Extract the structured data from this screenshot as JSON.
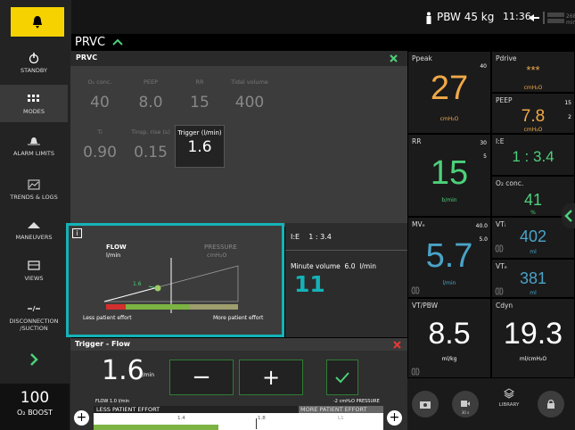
{
  "sidebar": {
    "standby": "STANDBY",
    "modes": "MODES",
    "alarm_limits": "ALARM LIMITS",
    "trends_logs": "TRENDS & LOGS",
    "maneuvers": "MANEUVERS",
    "views": "VIEWS",
    "disconnection": "DISCONNECTION /SUCTION",
    "o2_value": "100",
    "o2_label": "O₂ BOOST"
  },
  "topbar": {
    "pbw": "PBW 45 kg",
    "time": "11:36",
    "battery": "268 min"
  },
  "mode": {
    "title": "PRVC",
    "panel_title": "PRVC"
  },
  "params": [
    {
      "label": "O₂ conc.",
      "value": "40"
    },
    {
      "label": "PEEP",
      "value": "8.0"
    },
    {
      "label": "RR",
      "value": "15"
    },
    {
      "label": "Tidal volume",
      "value": "400"
    },
    {
      "label": "Ti",
      "value": "0.90"
    },
    {
      "label": "Tinsp. rise (s)",
      "value": "0.15"
    },
    {
      "label": "Trigger (l/min)",
      "value": "1.6"
    }
  ],
  "trigger_graph": {
    "info": "i",
    "flow_label": "FLOW",
    "flow_unit": "l/min",
    "pressure_label": "PRESSURE",
    "pressure_unit": "cmH₂O",
    "marker": "1.6",
    "less": "Less patient effort",
    "more": "More patient effort"
  },
  "info_right": {
    "ie": "I:E    1 : 3.4",
    "minute_volume": "Minute volume  6.0  l/min",
    "big_number": "11"
  },
  "trigger_panel": {
    "title": "Trigger - Flow",
    "value": "1.6",
    "unit": "l/min",
    "minus": "−",
    "plus": "+",
    "flow_note": "FLOW 1.0 l/min",
    "pressure_note": "-2 cmH₂O PRESSURE",
    "less": "LESS PATIENT EFFORT",
    "more": "MORE PATIENT EFFORT",
    "tick1": "1.4",
    "tick2": "1.8",
    "tick3": "L1"
  },
  "metrics": {
    "ppeak": {
      "label": "Ppeak",
      "value": "27",
      "unit": "cmH₂O",
      "limit": "40"
    },
    "pdrive": {
      "label": "Pdrive",
      "value": "***",
      "unit": "cmH₂O"
    },
    "peep": {
      "label": "PEEP",
      "value": "7.8",
      "unit": "cmH₂O",
      "hi": "15",
      "lo": "2"
    },
    "rr": {
      "label": "RR",
      "value": "15",
      "unit": "b/min",
      "hi": "30",
      "lo": "5"
    },
    "ie": {
      "label": "I:E",
      "value": "1 : 3.4"
    },
    "o2": {
      "label": "O₂ conc.",
      "value": "41",
      "unit": "%"
    },
    "mve": {
      "label": "MVₑ",
      "value": "5.7",
      "unit": "l/min",
      "hi": "40.0",
      "lo": "5.0"
    },
    "vti": {
      "label": "VTᵢ",
      "value": "402",
      "unit": "ml"
    },
    "vte": {
      "label": "VTₑ",
      "value": "381",
      "unit": "ml"
    },
    "vtpbw": {
      "label": "VT/PBW",
      "value": "8.5",
      "unit": "ml/kg"
    },
    "cdyn": {
      "label": "Cdyn",
      "value": "19.3",
      "unit": "ml/cmH₂O"
    }
  },
  "bottom": {
    "library": "LIBRARY",
    "timer": "30 s"
  },
  "colors": {
    "accent_teal": "#14b3b8",
    "orange": "#f0a848",
    "blue": "#4aa3c8",
    "green": "#4dd07a",
    "yellow": "#f6d300"
  }
}
